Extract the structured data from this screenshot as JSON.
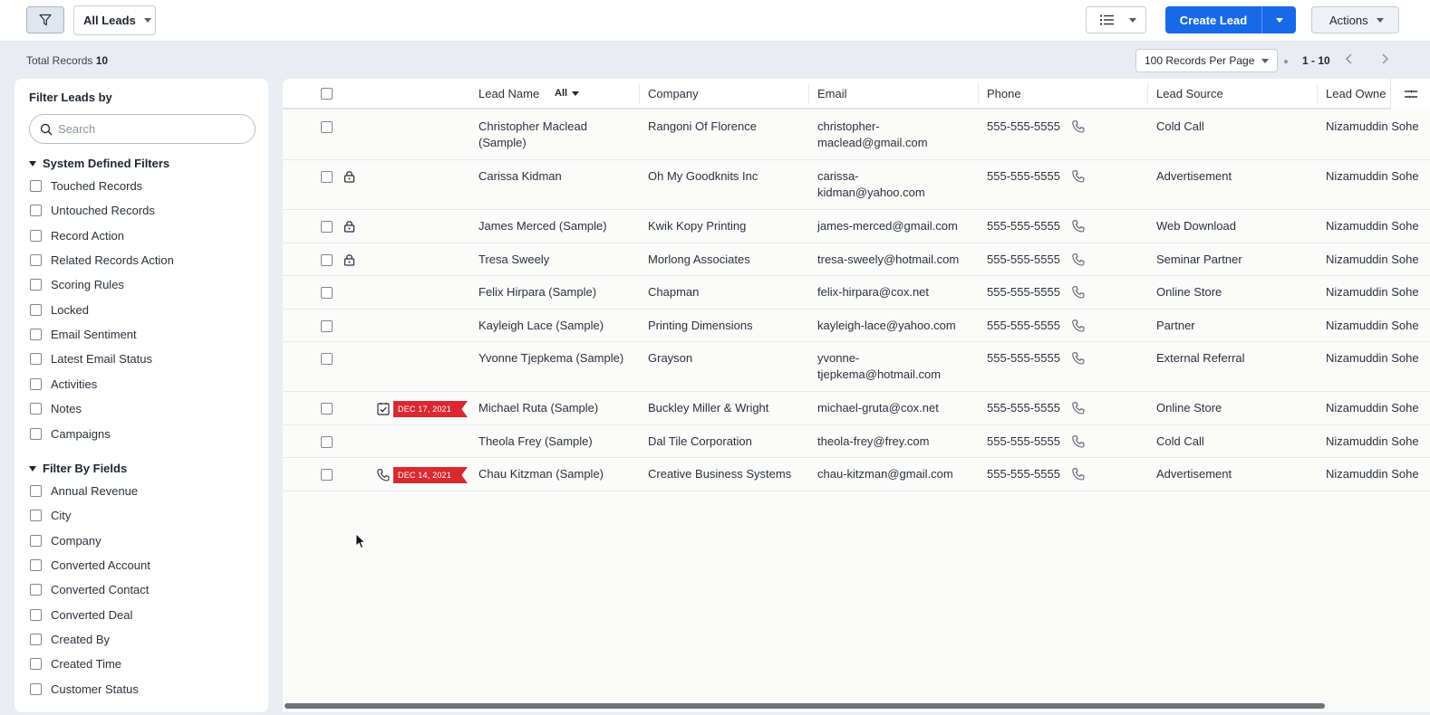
{
  "topbar": {
    "view_name": "All Leads",
    "create_label": "Create Lead",
    "actions_label": "Actions"
  },
  "summary": {
    "total_label": "Total Records",
    "total_count": "10",
    "records_per_page": "100 Records Per Page",
    "range": "1 - 10"
  },
  "sidebar": {
    "title": "Filter Leads by",
    "search_placeholder": "Search",
    "system_filters_title": "System Defined Filters",
    "system_filters": [
      "Touched Records",
      "Untouched Records",
      "Record Action",
      "Related Records Action",
      "Scoring Rules",
      "Locked",
      "Email Sentiment",
      "Latest Email Status",
      "Activities",
      "Notes",
      "Campaigns"
    ],
    "field_filters_title": "Filter By Fields",
    "field_filters": [
      "Annual Revenue",
      "City",
      "Company",
      "Converted Account",
      "Converted Contact",
      "Converted Deal",
      "Created By",
      "Created Time",
      "Customer Status"
    ]
  },
  "table": {
    "columns": {
      "lead_name": "Lead Name",
      "name_filter": "All",
      "company": "Company",
      "email": "Email",
      "phone": "Phone",
      "lead_source": "Lead Source",
      "lead_owner": "Lead Owne"
    },
    "rows": [
      {
        "name_l1": "Christopher Maclead",
        "name_l2": "(Sample)",
        "company": "Rangoni Of Florence",
        "email_l1": "christopher-",
        "email_l2": "maclead@gmail.com",
        "phone": "555-555-5555",
        "source": "Cold Call",
        "owner": "Nizamuddin Sohe"
      },
      {
        "name_l1": "Carissa Kidman",
        "company": "Oh My Goodknits Inc",
        "email_l1": "carissa-",
        "email_l2": "kidman@yahoo.com",
        "phone": "555-555-5555",
        "source": "Advertisement",
        "owner": "Nizamuddin Sohe"
      },
      {
        "name_l1": "James Merced (Sample)",
        "company": "Kwik Kopy Printing",
        "email_l1": "james-merced@gmail.com",
        "phone": "555-555-5555",
        "source": "Web Download",
        "owner": "Nizamuddin Sohe"
      },
      {
        "name_l1": "Tresa Sweely",
        "company": "Morlong Associates",
        "email_l1": "tresa-sweely@hotmail.com",
        "phone": "555-555-5555",
        "source": "Seminar Partner",
        "owner": "Nizamuddin Sohe"
      },
      {
        "name_l1": "Felix Hirpara (Sample)",
        "company": "Chapman",
        "email_l1": "felix-hirpara@cox.net",
        "phone": "555-555-5555",
        "source": "Online Store",
        "owner": "Nizamuddin Sohe"
      },
      {
        "name_l1": "Kayleigh Lace (Sample)",
        "company": "Printing Dimensions",
        "email_l1": "kayleigh-lace@yahoo.com",
        "phone": "555-555-5555",
        "source": "Partner",
        "owner": "Nizamuddin Sohe"
      },
      {
        "name_l1": "Yvonne Tjepkema (Sample)",
        "company": "Grayson",
        "email_l1": "yvonne-",
        "email_l2": "tjepkema@hotmail.com",
        "phone": "555-555-5555",
        "source": "External Referral",
        "owner": "Nizamuddin Sohe"
      },
      {
        "name_l1": "Michael Ruta (Sample)",
        "company": "Buckley Miller & Wright",
        "email_l1": "michael-gruta@cox.net",
        "phone": "555-555-5555",
        "source": "Online Store",
        "owner": "Nizamuddin Sohe",
        "tag": "DEC 17, 2021"
      },
      {
        "name_l1": "Theola Frey (Sample)",
        "company": "Dal Tile Corporation",
        "email_l1": "theola-frey@frey.com",
        "phone": "555-555-5555",
        "source": "Cold Call",
        "owner": "Nizamuddin Sohe"
      },
      {
        "name_l1": "Chau Kitzman (Sample)",
        "company": "Creative Business Systems",
        "email_l1": "chau-kitzman@gmail.com",
        "phone": "555-555-5555",
        "source": "Advertisement",
        "owner": "Nizamuddin Sohe",
        "tag": "DEC 14, 2021"
      }
    ]
  },
  "colors": {
    "primary": "#1769e8",
    "tag_red": "#d9282f"
  }
}
